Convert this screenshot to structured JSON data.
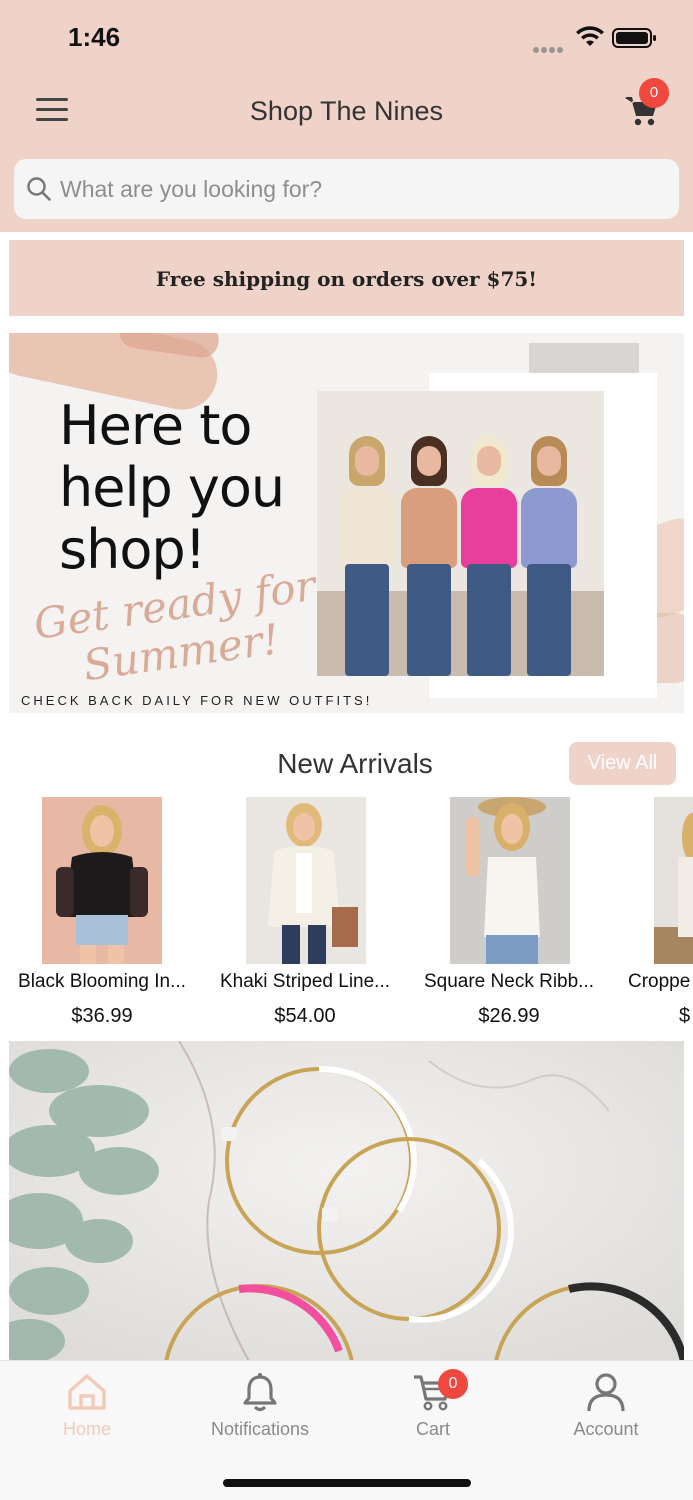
{
  "status_bar": {
    "time": "1:46"
  },
  "header": {
    "title": "Shop The Nines",
    "cart_count": "0",
    "search_placeholder": "What are you looking for?"
  },
  "promo_banner": {
    "text": "Free shipping on orders over $75!"
  },
  "hero": {
    "headline_lines": [
      "Here to",
      "help you",
      "shop!"
    ],
    "script_text": "Get ready for Summer!",
    "caption": "CHECK BACK DAILY FOR NEW OUTFITS!"
  },
  "new_arrivals": {
    "title": "New Arrivals",
    "view_all_label": "View All",
    "products": [
      {
        "name": "Black Blooming In...",
        "price": "$36.99"
      },
      {
        "name": "Khaki Striped Line...",
        "price": "$54.00"
      },
      {
        "name": "Square Neck Ribb...",
        "price": "$26.99"
      },
      {
        "name": "Croppe",
        "price": "$"
      }
    ]
  },
  "tabbar": {
    "tabs": [
      {
        "label": "Home",
        "icon": "home-icon",
        "active": true
      },
      {
        "label": "Notifications",
        "icon": "bell-icon",
        "active": false
      },
      {
        "label": "Cart",
        "icon": "cart-icon",
        "active": false
      },
      {
        "label": "Account",
        "icon": "user-icon",
        "active": false
      }
    ],
    "cart_badge": "0"
  },
  "colors": {
    "header_bg": "#efd3c9",
    "badge": "#f0483e",
    "active_tab": "#f3c9b8"
  }
}
